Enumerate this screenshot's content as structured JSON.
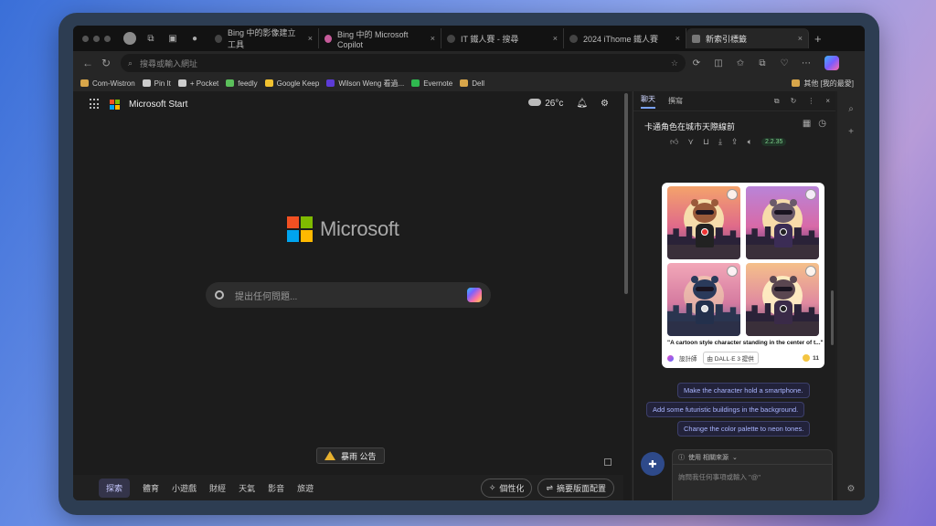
{
  "tabs": [
    {
      "label": "Bing 中的影像建立工具",
      "close": "×"
    },
    {
      "label": "Bing 中的 Microsoft Copilot",
      "close": "×"
    },
    {
      "label": "IT 鐵人賽 - 搜尋",
      "close": "×"
    },
    {
      "label": "2024 iThome 鐵人賽",
      "close": "×"
    },
    {
      "label": "新索引標籤",
      "close": "×",
      "active": true
    }
  ],
  "address": {
    "placeholder": "搜尋或輸入網址"
  },
  "bookmarks": [
    {
      "label": "Com-Wistron",
      "color": "#d8a64a"
    },
    {
      "label": "Pin It",
      "color": "#cccccc"
    },
    {
      "label": "+ Pocket",
      "color": "#cccccc"
    },
    {
      "label": "feedly",
      "color": "#5bbf5b"
    },
    {
      "label": "Google Keep",
      "color": "#f2c230"
    },
    {
      "label": "Wilson Weng 看過...",
      "color": "#5c3bd6"
    },
    {
      "label": "Evernote",
      "color": "#2fb84f"
    },
    {
      "label": "Dell",
      "color": "#d8a64a"
    }
  ],
  "bookmarks_right": "其他 [我的最愛]",
  "ms_start": {
    "label": "Microsoft Start",
    "temp": "26°c"
  },
  "brand": "Microsoft",
  "search": {
    "placeholder": "提出任何問題..."
  },
  "alert": {
    "label": "暴雨 公告"
  },
  "bottom_nav": {
    "items": [
      "探索",
      "體育",
      "小遊戲",
      "財經",
      "天氣",
      "影音",
      "旅遊"
    ],
    "personalize": "個性化",
    "layout": "摘要版面配置"
  },
  "sidebar": {
    "tabs": [
      "聊天",
      "撰寫"
    ],
    "title": "卡通角色在城市天際線前",
    "time_badge": "2.2.35",
    "card_caption": "\"A cartoon style character standing in the center of t...\"",
    "designer": "設計師",
    "source": "由 DALL·E 3 提供",
    "count": "11",
    "suggestions": [
      "Make the character hold a smartphone.",
      "Add some futuristic buildings in the background.",
      "Change the color palette to neon tones."
    ],
    "composer_top": "使用 相關來源",
    "composer_placeholder": "詢問我任何事項或輸入 \"@\""
  },
  "colors": {
    "accent": "#7aa2ff",
    "ms_red": "#f25022",
    "ms_green": "#7fba00",
    "ms_blue": "#00a4ef",
    "ms_yellow": "#ffb900"
  }
}
